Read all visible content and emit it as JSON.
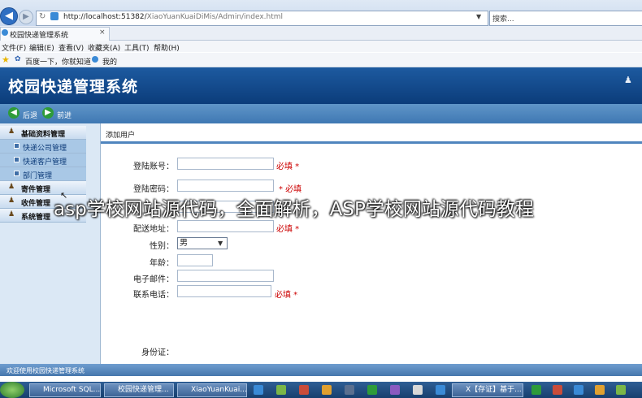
{
  "browser": {
    "address_host": "http://localhost:51382/",
    "address_path": "XiaoYuanKuaiDiMis/Admin/index.html",
    "search_placeholder": "搜索...",
    "tab_title": "校园快递管理系统",
    "tab_close": "×",
    "menu": [
      "文件(F)",
      "编辑(E)",
      "查看(V)",
      "收藏夹(A)",
      "工具(T)",
      "帮助(H)"
    ],
    "favorites": [
      "百度一下，你就知道",
      "我的"
    ]
  },
  "app": {
    "title": "校园快递管理系统",
    "toolbar": {
      "back_label": "后退",
      "forward_label": "前进"
    },
    "sidebar": [
      {
        "label": "基础资料管理",
        "type": "group"
      },
      {
        "label": "快递公司管理",
        "type": "sub"
      },
      {
        "label": "快递客户管理",
        "type": "sub"
      },
      {
        "label": "部门管理",
        "type": "sub"
      },
      {
        "label": "寄件管理",
        "type": "group"
      },
      {
        "label": "收件管理",
        "type": "group"
      },
      {
        "label": "系统管理",
        "type": "group"
      }
    ],
    "content_title": "添加用户",
    "form": {
      "login_account": "登陆账号：",
      "login_password": "登陆密码：",
      "delivery_address": "配送地址：",
      "gender": "性别：",
      "gender_value": "男",
      "age": "年龄：",
      "email": "电子邮件：",
      "phone": "联系电话：",
      "id_card": "身份证：",
      "req_account": "必填 *",
      "req_password": "* 必填",
      "req_address": "必填 *",
      "req_phone": "必填 *"
    },
    "footer": "欢迎使用校园快递管理系统"
  },
  "watermark": "asp学校网站源代码，全面解析，ASP学校网站源代码教程",
  "taskbar": {
    "buttons": [
      "Microsoft SQL...",
      "校园快递管理...",
      "XiaoYuanKuai...",
      "X【存证】基于..."
    ]
  }
}
